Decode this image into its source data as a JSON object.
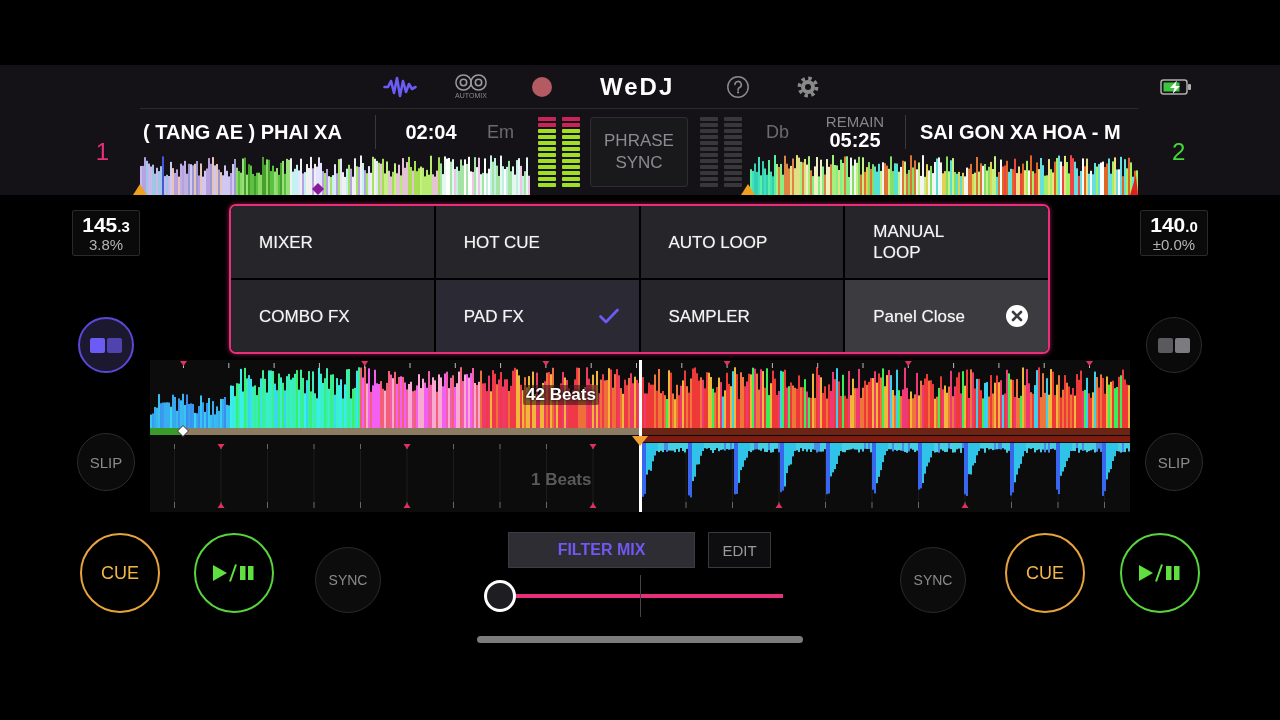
{
  "toolbar": {
    "waveform_view": {
      "selected": true
    },
    "automix_label": "AUTOMIX",
    "logo": "WeDJ"
  },
  "decks": [
    {
      "number": "1",
      "color": "#e8307a",
      "title": "( TANG AE ) PHAI XA",
      "time": "02:04",
      "key": "Em",
      "meter": {
        "level": 1
      },
      "bpm": "145",
      "bpm_fraction": ".3",
      "pitch": "3.8%",
      "layout_button": {
        "selected": true
      },
      "beats_label": "42 Beats",
      "slip": "SLIP",
      "cue": "CUE",
      "sync": "SYNC"
    },
    {
      "number": "2",
      "color": "#45d83a",
      "title": "SAI GON XA HOA - M",
      "time_label": "REMAIN",
      "time": "05:25",
      "key": "Db",
      "meter": {
        "level": 0
      },
      "bpm": "140",
      "bpm_fraction": ".0",
      "pitch": "±0.0%",
      "layout_button": {
        "selected": false
      },
      "beats_label": "1 Beats",
      "slip": "SLIP",
      "cue": "CUE",
      "sync": "SYNC"
    }
  ],
  "phrase_sync": "PHRASE SYNC",
  "panel": {
    "items": [
      {
        "kind": "mode",
        "label": "MIXER",
        "selected": false
      },
      {
        "kind": "mode",
        "label": "HOT CUE",
        "selected": false
      },
      {
        "kind": "mode",
        "label": "AUTO LOOP",
        "selected": false
      },
      {
        "kind": "mode",
        "label": "MANUAL LOOP",
        "selected": false
      },
      {
        "kind": "mode",
        "label": "COMBO FX",
        "selected": false
      },
      {
        "kind": "mode",
        "label": "PAD FX",
        "selected": true
      },
      {
        "kind": "mode",
        "label": "SAMPLER",
        "selected": false
      },
      {
        "kind": "close",
        "label": "Panel Close"
      }
    ]
  },
  "filter": {
    "mode": "FILTER MIX",
    "edit": "EDIT",
    "slider": {
      "level": 0
    }
  }
}
